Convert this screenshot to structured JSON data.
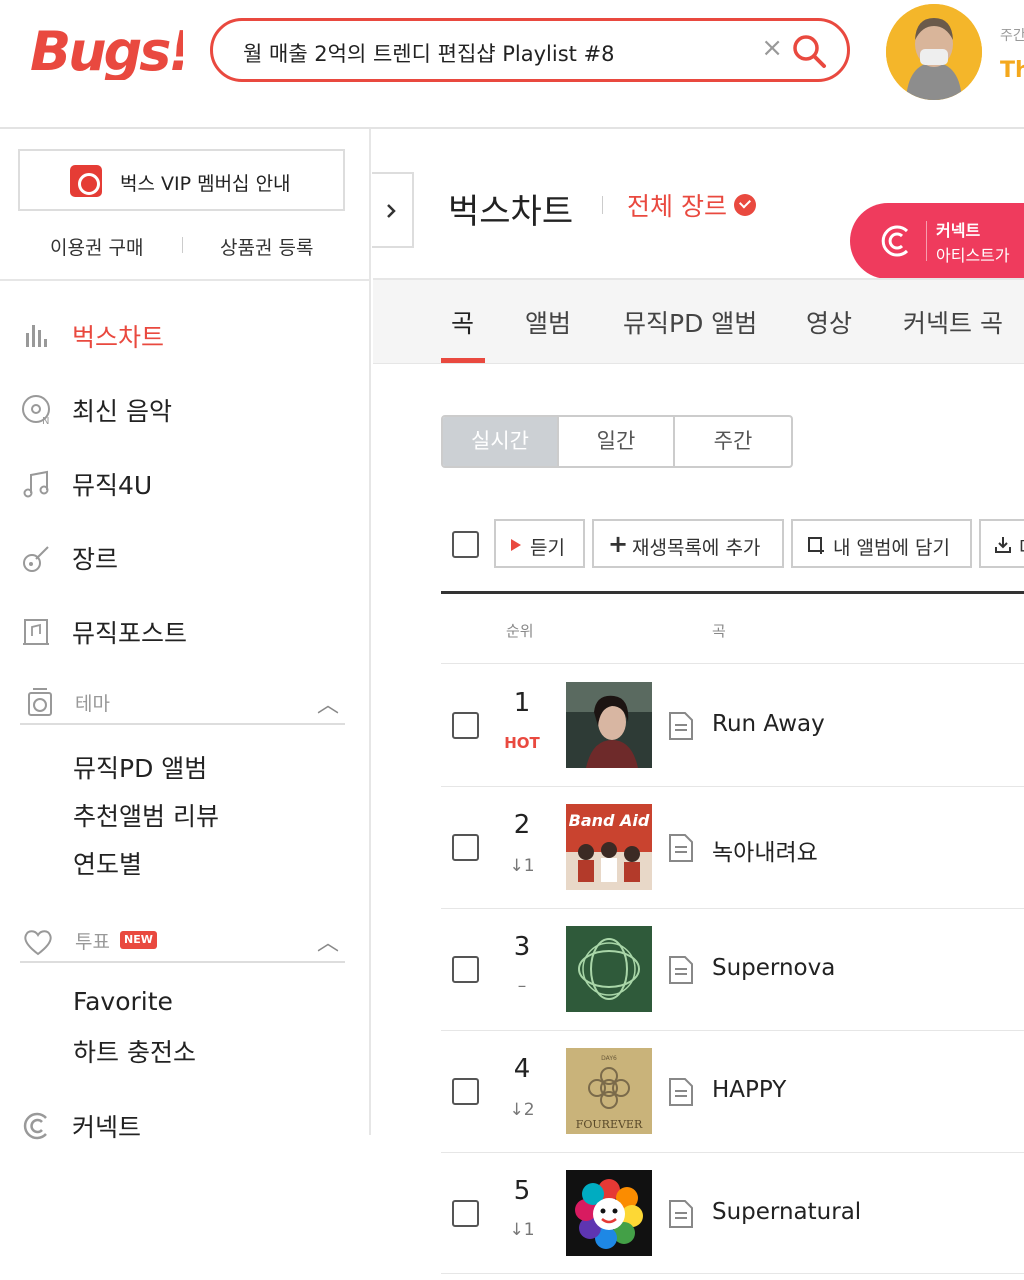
{
  "header": {
    "logo_text": "Bugs!",
    "search_value": "월 매출 2억의 트렌디 편집샵 Playlist #8",
    "user_sub": "주간",
    "user_name": "Th"
  },
  "sidebar": {
    "vip_label": "벅스 VIP 멤버십 안내",
    "buy_pass": "이용권 구매",
    "register_voucher": "상품권 등록",
    "nav": [
      {
        "label": "벅스차트",
        "icon": "chart-bars-icon",
        "active": true
      },
      {
        "label": "최신 음악",
        "icon": "new-music-icon"
      },
      {
        "label": "뮤직4U",
        "icon": "music-note-icon"
      },
      {
        "label": "장르",
        "icon": "guitar-icon"
      },
      {
        "label": "뮤직포스트",
        "icon": "post-icon"
      }
    ],
    "theme": {
      "label": "테마",
      "items": [
        "뮤직PD 앨범",
        "추천앨범 리뷰",
        "연도별"
      ]
    },
    "vote": {
      "label": "투표",
      "badge": "NEW",
      "items": [
        "Favorite",
        "하트 충전소"
      ]
    },
    "connect": "커넥트"
  },
  "main": {
    "title": "벅스차트",
    "genre": "전체 장르",
    "banner": {
      "line1": "커넥트",
      "line2": "아티스트가"
    },
    "tabs": [
      "곡",
      "앨범",
      "뮤직PD 앨범",
      "영상",
      "커넥트 곡"
    ],
    "periods": [
      "실시간",
      "일간",
      "주간"
    ],
    "toolbar": {
      "play": "듣기",
      "add_playlist": "재생목록에 추가",
      "add_album": "내 앨범에 담기",
      "download": "다"
    },
    "columns": {
      "rank": "순위",
      "song": "곡"
    },
    "songs": [
      {
        "rank": "1",
        "change": "HOT",
        "title": "Run Away"
      },
      {
        "rank": "2",
        "change": "↓1",
        "title": "녹아내려요"
      },
      {
        "rank": "3",
        "change": "–",
        "title": "Supernova"
      },
      {
        "rank": "4",
        "change": "↓2",
        "title": "HAPPY"
      },
      {
        "rank": "5",
        "change": "↓1",
        "title": "Supernatural"
      }
    ],
    "covers": [
      {
        "label": ""
      },
      {
        "label": "Band Aid"
      },
      {
        "label": ""
      },
      {
        "label": "FOUREVER",
        "top": "DAY6"
      },
      {
        "label": ""
      }
    ]
  },
  "colors": {
    "accent": "#e9493f",
    "banner": "#ef3b5d",
    "user": "#f4a81c"
  }
}
